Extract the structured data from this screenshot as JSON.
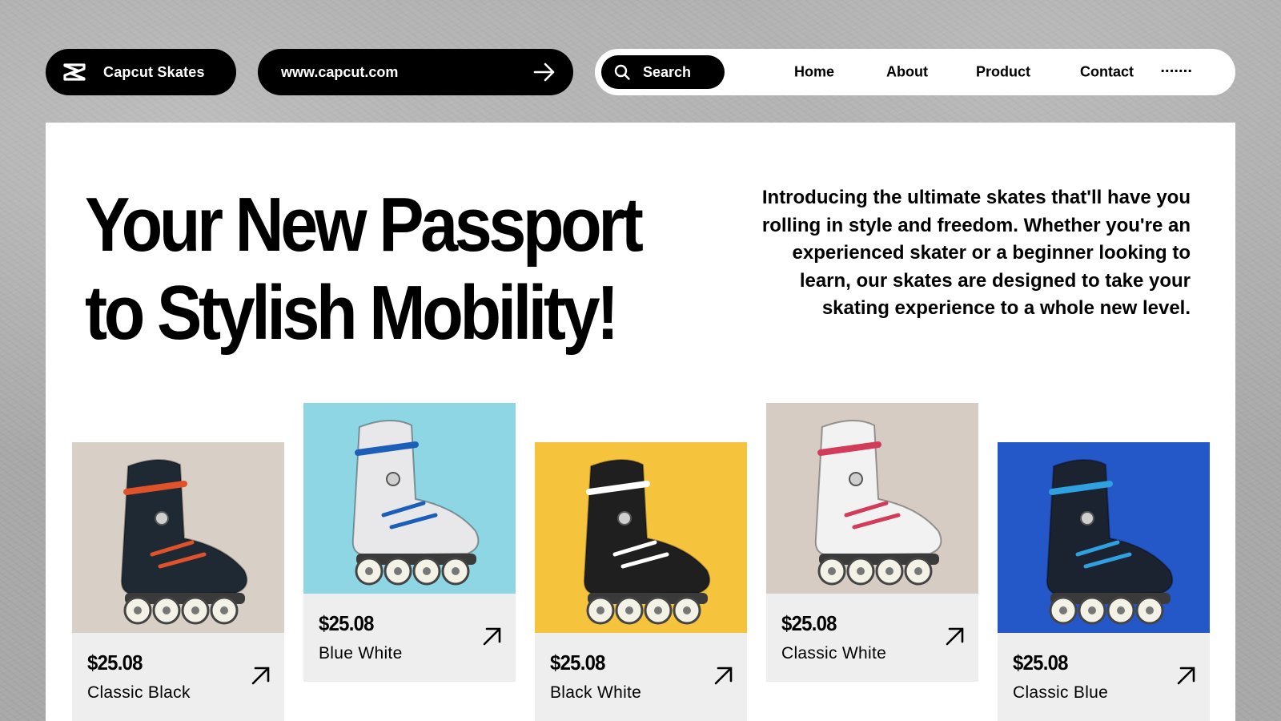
{
  "header": {
    "brand": "Capcut Skates",
    "url": "www.capcut.com",
    "search_label": "Search",
    "nav": [
      "Home",
      "About",
      "Product",
      "Contact"
    ],
    "more": "·······"
  },
  "hero": {
    "line1": "Your New Passport",
    "line2": "to Stylish Mobility!",
    "intro": "Introducing the ultimate skates that'll have you rolling in style and freedom. Whether you're an experienced skater or a beginner looking to learn, our skates are designed to take your skating experience to a whole new level."
  },
  "products": [
    {
      "price": "$25.08",
      "name": "Classic Black",
      "bg": "#d8cfc6",
      "boot": "#1f2933",
      "accent": "#e0522a"
    },
    {
      "price": "$25.08",
      "name": "Blue White",
      "bg": "#8fd6e4",
      "boot": "#e8e8ea",
      "accent": "#1c5fb8"
    },
    {
      "price": "$25.08",
      "name": "Black White",
      "bg": "#f6c43c",
      "boot": "#1f1f1f",
      "accent": "#ffffff"
    },
    {
      "price": "$25.08",
      "name": "Classic White",
      "bg": "#d6ccc3",
      "boot": "#f2f2f2",
      "accent": "#d23b5a"
    },
    {
      "price": "$25.08",
      "name": "Classic Blue",
      "bg": "#2457c8",
      "boot": "#1b2230",
      "accent": "#2fa0e0"
    }
  ]
}
